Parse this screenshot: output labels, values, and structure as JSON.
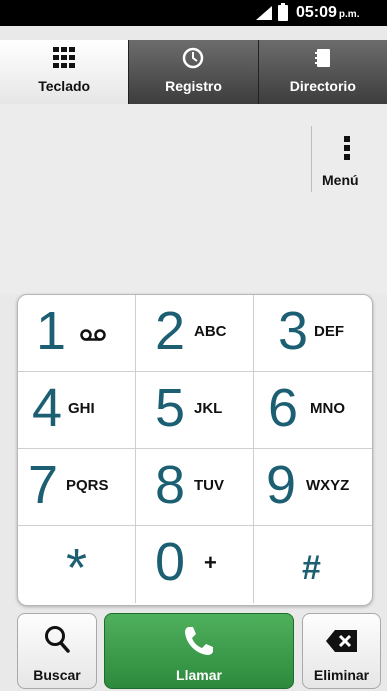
{
  "status_bar": {
    "time": "05:09",
    "ampm": "p.m."
  },
  "tabs": [
    {
      "label": "Teclado",
      "icon": "keypad-grid-icon",
      "active": true
    },
    {
      "label": "Registro",
      "icon": "clock-icon",
      "active": false
    },
    {
      "label": "Directorio",
      "icon": "contacts-book-icon",
      "active": false
    }
  ],
  "menu": {
    "label": "Menú"
  },
  "keypad": {
    "keys": [
      {
        "digit": "1",
        "letters": "",
        "icon": "voicemail-icon"
      },
      {
        "digit": "2",
        "letters": "ABC"
      },
      {
        "digit": "3",
        "letters": "DEF"
      },
      {
        "digit": "4",
        "letters": "GHI"
      },
      {
        "digit": "5",
        "letters": "JKL"
      },
      {
        "digit": "6",
        "letters": "MNO"
      },
      {
        "digit": "7",
        "letters": "PQRS"
      },
      {
        "digit": "8",
        "letters": "TUV"
      },
      {
        "digit": "9",
        "letters": "WXYZ"
      },
      {
        "digit": "*",
        "letters": ""
      },
      {
        "digit": "0",
        "letters": "+"
      },
      {
        "digit": "#",
        "letters": ""
      }
    ]
  },
  "actions": {
    "search_label": "Buscar",
    "call_label": "Llamar",
    "delete_label": "Eliminar"
  },
  "colors": {
    "digit": "#1c5f72",
    "call_button": "#3a9a48"
  }
}
